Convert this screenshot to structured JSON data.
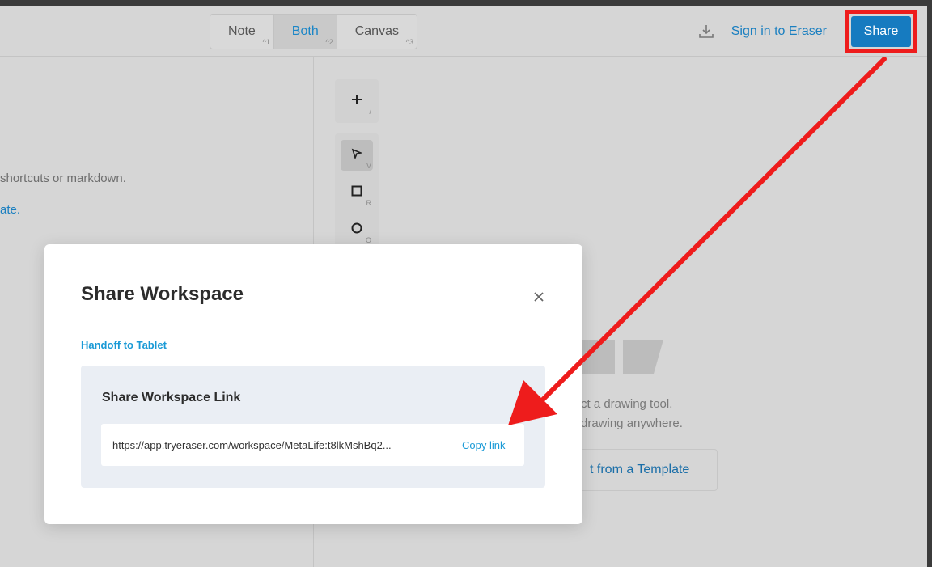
{
  "header": {
    "view_tabs": [
      {
        "label": "Note",
        "shortcut": "^1",
        "active": false
      },
      {
        "label": "Both",
        "shortcut": "^2",
        "active": true
      },
      {
        "label": "Canvas",
        "shortcut": "^3",
        "active": false
      }
    ],
    "download_icon": "download-icon",
    "sign_in_label": "Sign in to Eraser",
    "share_label": "Share"
  },
  "note_pane": {
    "hint_text": "shortcuts or markdown.",
    "template_hint": "ate."
  },
  "canvas_pane": {
    "tools": [
      {
        "icon": "plus-icon",
        "shortcut": "/"
      },
      {
        "icon": "pointer-icon",
        "shortcut": "V"
      },
      {
        "icon": "rectangle-icon",
        "shortcut": "R"
      },
      {
        "icon": "circle-icon",
        "shortcut": "O"
      }
    ],
    "hint_line_1": "ct a drawing tool.",
    "hint_line_2": "drawing anywhere.",
    "template_button": "t from a Template"
  },
  "modal": {
    "title": "Share Workspace",
    "handoff_label": "Handoff to Tablet",
    "panel_title": "Share Workspace Link",
    "link_url": "https://app.tryeraser.com/workspace/MetaLife:t8lkMshBq2...",
    "copy_label": "Copy link"
  },
  "colors": {
    "accent": "#167bc0",
    "link": "#1a9ad6",
    "annotation": "#ee1c1c"
  }
}
